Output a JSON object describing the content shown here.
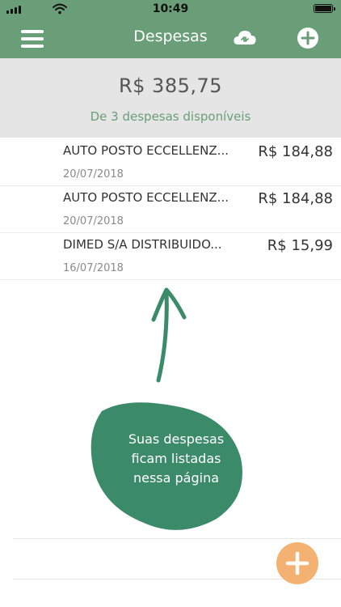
{
  "status_bar": {
    "time": "10:49"
  },
  "header": {
    "title": "Despesas"
  },
  "summary": {
    "total": "R$  385,75",
    "caption": "De 3 despesas disponíveis"
  },
  "expenses": [
    {
      "name": "AUTO POSTO ECCELLENZ...",
      "value": "R$ 184,88",
      "date": "20/07/2018"
    },
    {
      "name": "AUTO POSTO ECCELLENZ...",
      "value": "R$ 184,88",
      "date": "20/07/2018"
    },
    {
      "name": "DIMED S/A DISTRIBUIDO...",
      "value": "R$ 15,99",
      "date": "16/07/2018"
    }
  ],
  "hint": {
    "line1": "Suas despesas",
    "line2": "ficam listadas",
    "line3": "nessa página"
  },
  "colors": {
    "primary": "#6a9e78",
    "accent": "#f3b271",
    "hint_blob": "#3b8a6a",
    "summary_bg": "#e5e5e5"
  },
  "icons": {
    "menu": "hamburger-menu-icon",
    "sync": "cloud-sync-icon",
    "add": "plus-circle-icon",
    "fab": "plus-icon"
  }
}
